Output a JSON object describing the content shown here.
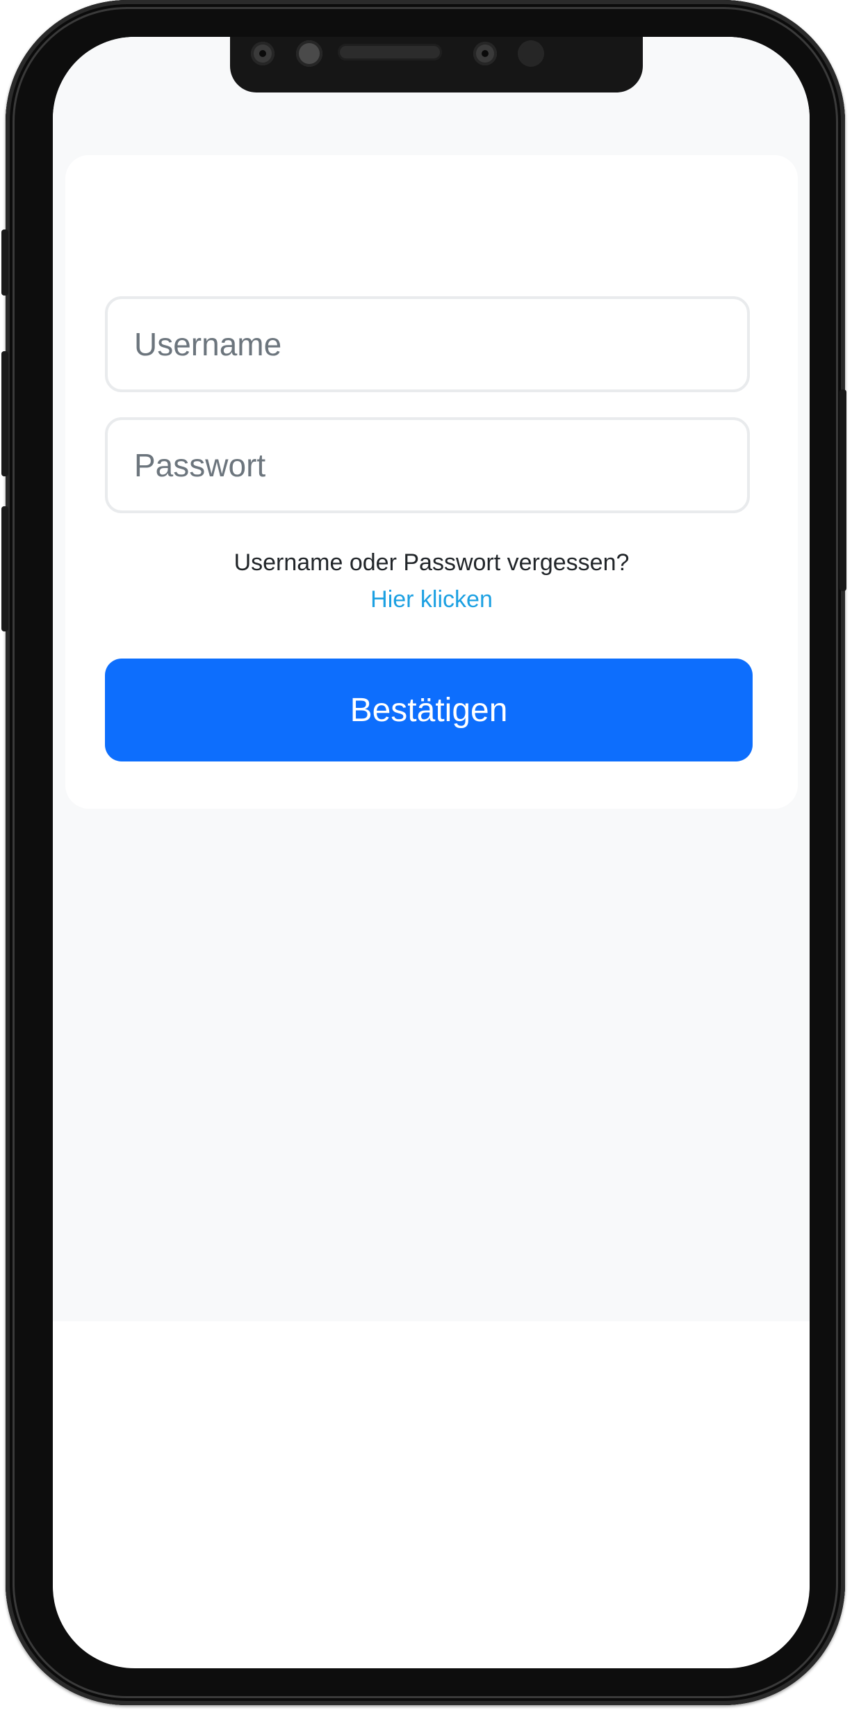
{
  "login": {
    "username_placeholder": "Username",
    "password_placeholder": "Passwort",
    "forgot_text": "Username oder Passwort vergessen?",
    "forgot_link": "Hier klicken",
    "submit_label": "Bestätigen"
  },
  "colors": {
    "primary": "#0d6efd",
    "link": "#1ba0e2",
    "app_background": "#f8f9fa",
    "card": "#ffffff",
    "input_border": "#e9ebed",
    "placeholder": "#6c757d",
    "text": "#212529"
  }
}
